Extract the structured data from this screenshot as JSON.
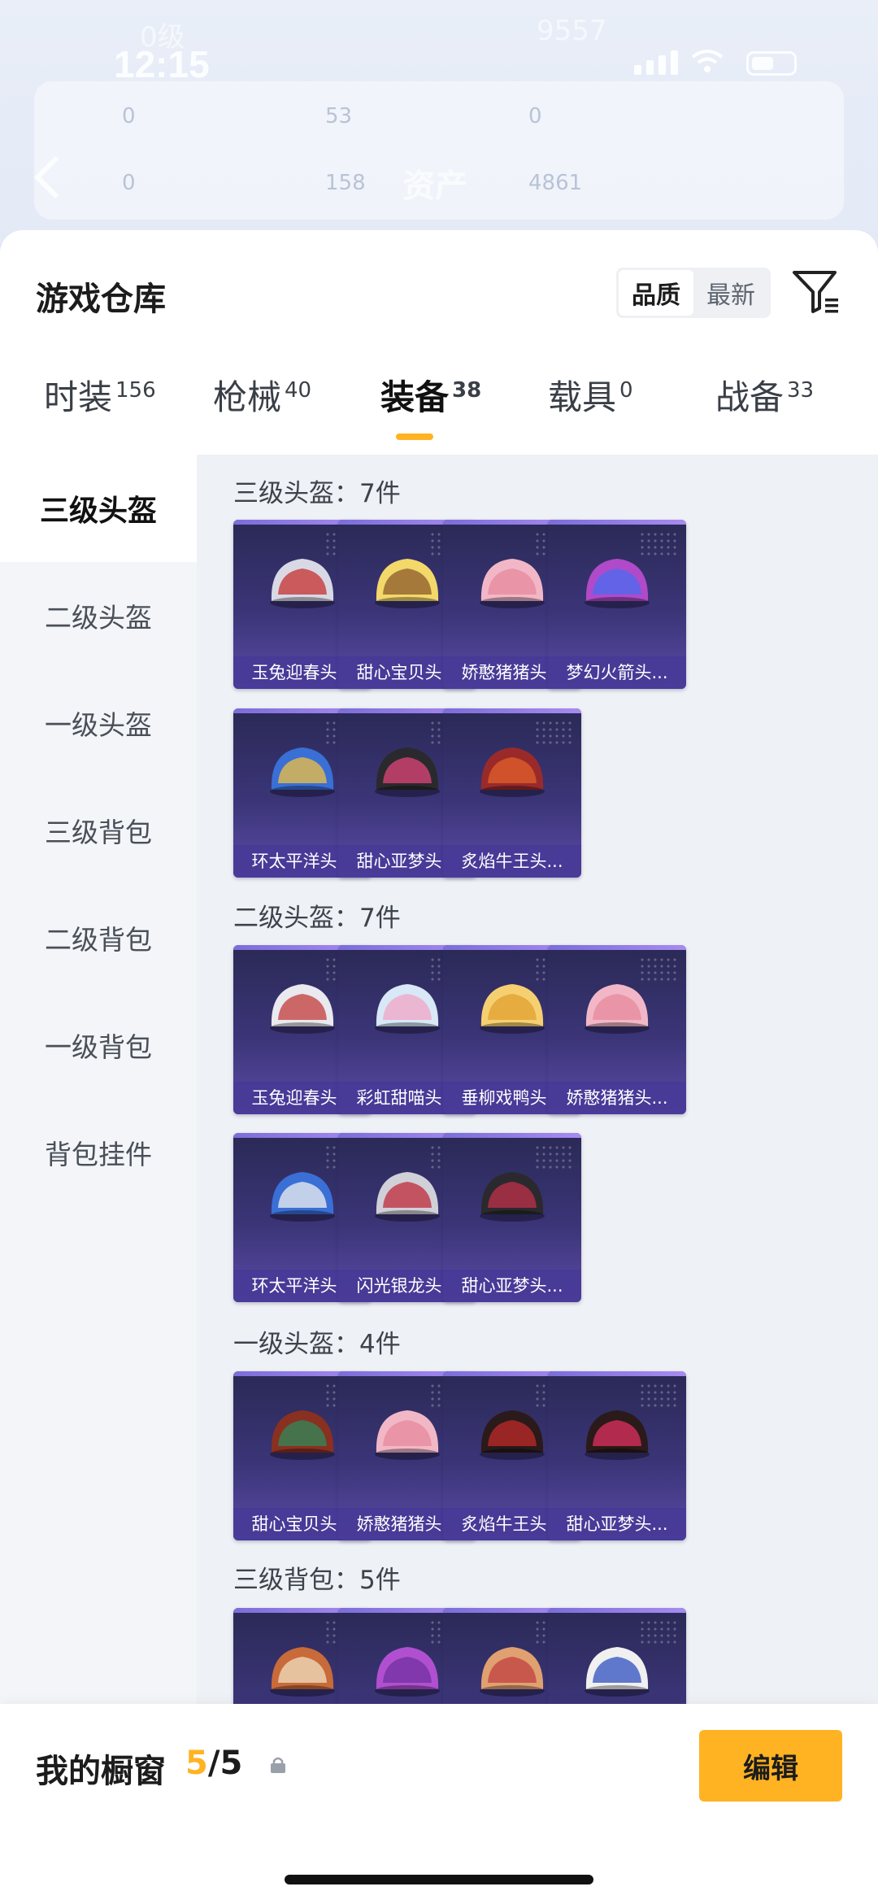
{
  "status_bar": {
    "time": "12:15",
    "faded_left": "0级",
    "faded_right": "9557"
  },
  "background_card": {
    "stats": [
      "0",
      "53",
      "0",
      "0",
      "158",
      "4861"
    ],
    "title": "资产"
  },
  "header": {
    "title": "游戏仓库",
    "sort_options": [
      "品质",
      "最新"
    ],
    "active_sort": "品质"
  },
  "tabs": [
    {
      "label": "时装",
      "count": "156"
    },
    {
      "label": "枪械",
      "count": "40"
    },
    {
      "label": "装备",
      "count": "38"
    },
    {
      "label": "载具",
      "count": "0"
    },
    {
      "label": "战备",
      "count": "33"
    }
  ],
  "active_tab": "装备",
  "sidebar": {
    "items": [
      "三级头盔",
      "二级头盔",
      "一级头盔",
      "三级背包",
      "二级背包",
      "一级背包",
      "背包挂件"
    ],
    "active": "三级头盔"
  },
  "sections": [
    {
      "title": "三级头盔：7件",
      "items": [
        "玉兔迎春头...",
        "甜心宝贝头...",
        "娇憨猪猪头...",
        "梦幻火箭头...",
        "环太平洋头...",
        "甜心亚梦头...",
        "炙焰牛王头..."
      ]
    },
    {
      "title": "二级头盔：7件",
      "items": [
        "玉兔迎春头...",
        "彩虹甜喵头...",
        "垂柳戏鸭头...",
        "娇憨猪猪头...",
        "环太平洋头...",
        "闪光银龙头...",
        "甜心亚梦头..."
      ]
    },
    {
      "title": "一级头盔：4件",
      "items": [
        "甜心宝贝头...",
        "娇憨猪猪头...",
        "炙焰牛王头...",
        "甜心亚梦头..."
      ]
    },
    {
      "title": "三级背包：5件",
      "items": [
        "",
        "",
        "",
        ""
      ]
    }
  ],
  "colors": {
    "accent": "#ffb322",
    "card_top": "#2a2955",
    "card_bottom": "#5b4aa6"
  },
  "bottom_bar": {
    "title": "我的橱窗",
    "current": "5",
    "separator": "/",
    "total": "5",
    "edit_label": "编辑"
  }
}
